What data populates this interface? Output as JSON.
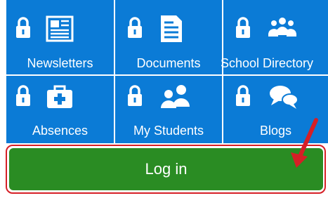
{
  "tiles": [
    {
      "label": "Newsletters",
      "icon": "newspaper-icon",
      "locked": true
    },
    {
      "label": "Documents",
      "icon": "document-icon",
      "locked": true
    },
    {
      "label": "School Directory",
      "icon": "people-group-icon",
      "locked": true
    },
    {
      "label": "Absences",
      "icon": "first-aid-kit-icon",
      "locked": true
    },
    {
      "label": "My Students",
      "icon": "students-icon",
      "locked": true
    },
    {
      "label": "Blogs",
      "icon": "chat-bubbles-icon",
      "locked": true
    }
  ],
  "login": {
    "label": "Log in"
  },
  "colors": {
    "tile_blue": "#0b7bd6",
    "login_green": "#2a8c23",
    "highlight_red": "#d61f26"
  }
}
